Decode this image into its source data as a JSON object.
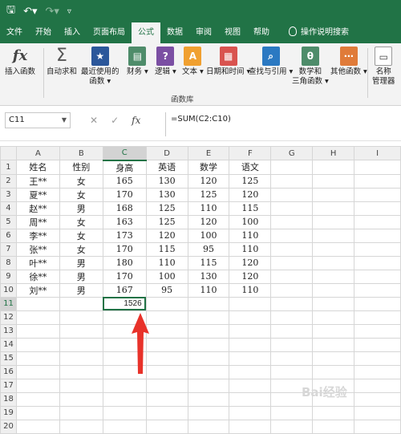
{
  "quick_access": {
    "save_icon": "save-icon",
    "undo_icon": "undo-icon",
    "redo_icon": "redo-icon"
  },
  "tabs": [
    "文件",
    "开始",
    "插入",
    "页面布局",
    "公式",
    "数据",
    "审阅",
    "视图",
    "帮助"
  ],
  "active_tab": "公式",
  "tell_me": "操作说明搜索",
  "ribbon": {
    "insert_function": "插入函数",
    "autosum_line1": "自动求和",
    "recent_line1": "最近使用的",
    "recent_line2": "函数",
    "financial": "财务",
    "logical": "逻辑",
    "text": "文本",
    "datetime": "日期和时间",
    "lookup": "查找与引用",
    "math_line1": "数学和",
    "math_line2": "三角函数",
    "other": "其他函数",
    "name_line1": "名称",
    "name_line2": "管理器",
    "group_label": "函数库"
  },
  "formula_bar": {
    "name_box": "C11",
    "fx_label": "fx",
    "formula": "=SUM(C2:C10)"
  },
  "columns": [
    "A",
    "B",
    "C",
    "D",
    "E",
    "F",
    "G",
    "H",
    "I"
  ],
  "rows": [
    [
      "姓名",
      "性别",
      "身高",
      "英语",
      "数学",
      "语文"
    ],
    [
      "王**",
      "女",
      "165",
      "130",
      "120",
      "125"
    ],
    [
      "夏**",
      "女",
      "170",
      "130",
      "125",
      "120"
    ],
    [
      "赵**",
      "男",
      "168",
      "125",
      "110",
      "115"
    ],
    [
      "周**",
      "女",
      "163",
      "125",
      "120",
      "100"
    ],
    [
      "李**",
      "女",
      "173",
      "120",
      "100",
      "110"
    ],
    [
      "张**",
      "女",
      "170",
      "115",
      "95",
      "110"
    ],
    [
      "叶**",
      "男",
      "180",
      "110",
      "115",
      "120"
    ],
    [
      "徐**",
      "男",
      "170",
      "100",
      "130",
      "120"
    ],
    [
      "刘**",
      "男",
      "167",
      "95",
      "110",
      "110"
    ]
  ],
  "result_cell": {
    "address": "C11",
    "value": "1526"
  },
  "row_count": 20,
  "accent_color": "#217346",
  "arrow_color": "#e8322a",
  "watermark": "Bai经验"
}
